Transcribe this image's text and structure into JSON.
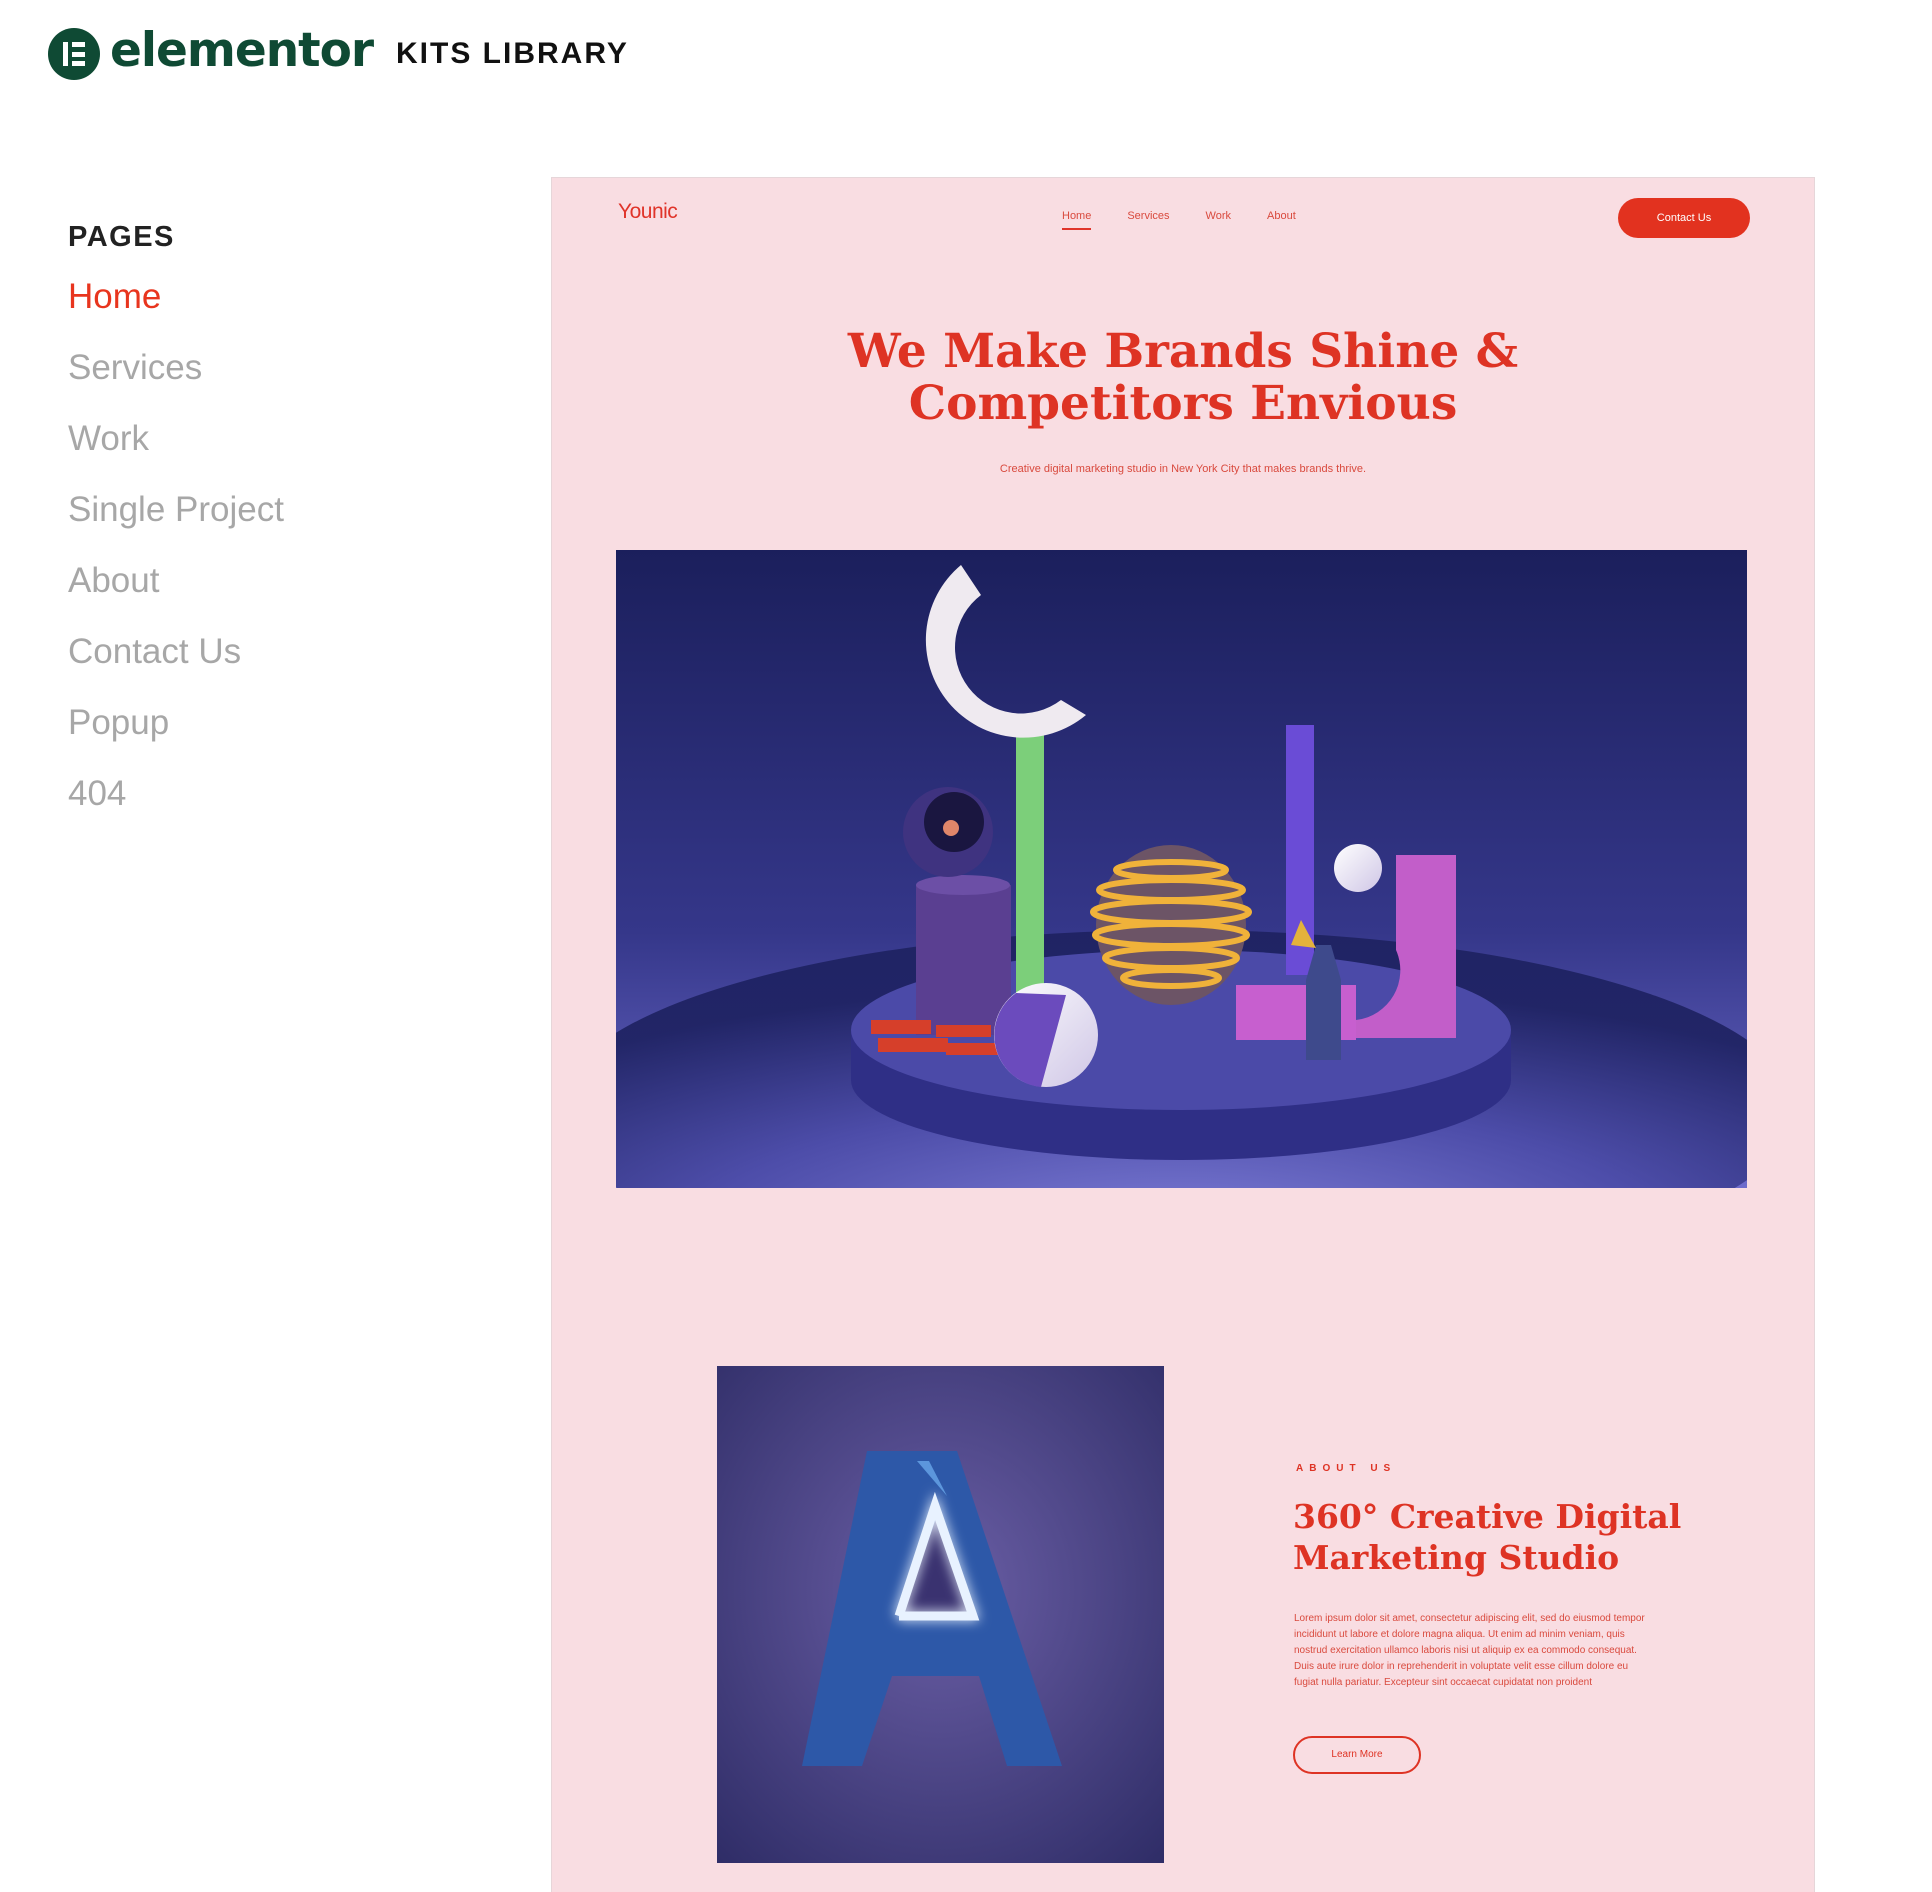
{
  "header": {
    "brand_word": "elementor",
    "brand_icon": "elementor-logo-icon",
    "title": "KITS LIBRARY",
    "brand_color": "#0f4a34"
  },
  "sidebar": {
    "heading": "PAGES",
    "active_color": "#e8351e",
    "items": [
      {
        "label": "Home",
        "active": true
      },
      {
        "label": "Services",
        "active": false
      },
      {
        "label": "Work",
        "active": false
      },
      {
        "label": "Single Project",
        "active": false
      },
      {
        "label": "About",
        "active": false
      },
      {
        "label": "Contact Us",
        "active": false
      },
      {
        "label": "Popup",
        "active": false
      },
      {
        "label": "404",
        "active": false
      }
    ]
  },
  "preview": {
    "background": "#f9dde2",
    "accent": "#e2321f",
    "site_logo": "Younic",
    "nav": [
      {
        "label": "Home",
        "active": true
      },
      {
        "label": "Services",
        "active": false
      },
      {
        "label": "Work",
        "active": false
      },
      {
        "label": "About",
        "active": false
      }
    ],
    "cta_label": "Contact Us",
    "hero_title_line1": "We Make Brands Shine &",
    "hero_title_line2": "Competitors Envious",
    "hero_subtitle": "Creative digital marketing studio in New York City that makes brands thrive.",
    "hero_image": "3d-abstract-shapes-scene",
    "about": {
      "image": "neon-letter-a-image",
      "eyebrow": "ABOUT US",
      "title_line1": "360° Creative Digital",
      "title_line2": "Marketing Studio",
      "body": "Lorem ipsum dolor sit amet, consectetur adipiscing elit, sed do eiusmod tempor incididunt ut labore et dolore magna aliqua. Ut enim ad minim veniam, quis nostrud exercitation ullamco laboris nisi ut aliquip ex ea commodo consequat. Duis aute irure dolor in reprehenderit in voluptate velit esse cillum dolore eu fugiat nulla pariatur. Excepteur sint occaecat cupidatat non proident",
      "button_label": "Learn More"
    }
  }
}
